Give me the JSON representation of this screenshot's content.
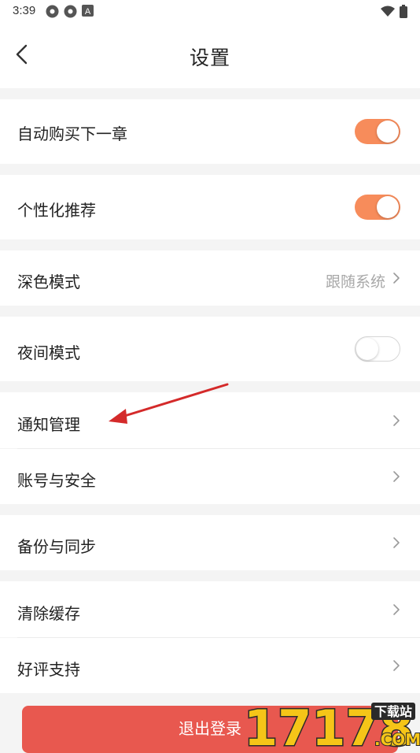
{
  "status_bar": {
    "time": "3:39",
    "icons": [
      "app-icon-1",
      "app-icon-2",
      "a-icon",
      "wifi-icon",
      "battery-icon"
    ]
  },
  "header": {
    "title": "设置",
    "back_icon": "chevron-left-icon"
  },
  "settings": {
    "auto_buy": {
      "label": "自动购买下一章",
      "enabled": true
    },
    "personalized": {
      "label": "个性化推荐",
      "enabled": true
    },
    "dark_mode": {
      "label": "深色模式",
      "value": "跟随系统"
    },
    "night_mode": {
      "label": "夜间模式",
      "enabled": false
    },
    "notifications": {
      "label": "通知管理"
    },
    "account": {
      "label": "账号与安全"
    },
    "backup": {
      "label": "备份与同步"
    },
    "clear_cache": {
      "label": "清除缓存"
    },
    "rate": {
      "label": "好评支持"
    }
  },
  "logout": {
    "label": "退出登录"
  },
  "watermark": {
    "text": "17178",
    "sub": "下载站",
    "suffix": ".COM"
  },
  "colors": {
    "accent": "#f78c5b",
    "logout": "#e8584f",
    "annotation": "#d42a2a"
  }
}
